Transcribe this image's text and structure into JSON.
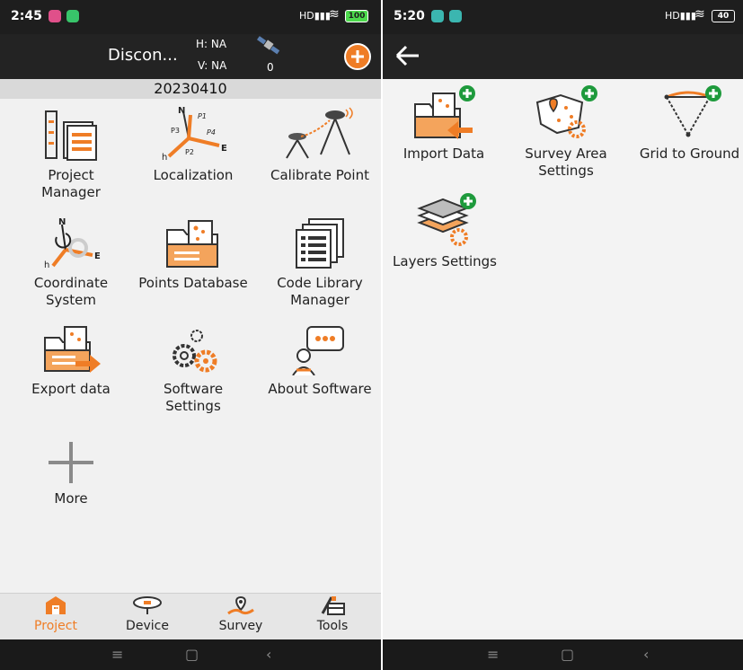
{
  "left": {
    "status": {
      "time": "2:45",
      "battery": "100"
    },
    "header": {
      "connection": "Discon...",
      "h_label": "H: NA",
      "v_label": "V: NA",
      "sat_count": "0"
    },
    "project_date": "20230410",
    "menu": [
      {
        "line1": "Project",
        "line2": "Manager"
      },
      {
        "line1": "Localization",
        "line2": ""
      },
      {
        "line1": "Calibrate Point",
        "line2": ""
      },
      {
        "line1": "Coordinate",
        "line2": "System"
      },
      {
        "line1": "Points Database",
        "line2": ""
      },
      {
        "line1": "Code Library",
        "line2": "Manager"
      },
      {
        "line1": "Export data",
        "line2": ""
      },
      {
        "line1": "Software",
        "line2": "Settings"
      },
      {
        "line1": "About Software",
        "line2": ""
      },
      {
        "line1": "More",
        "line2": ""
      }
    ],
    "localization_labels": {
      "n": "N",
      "e": "E",
      "h": "h",
      "p1": "P1",
      "p2": "P2",
      "p3": "P3",
      "p4": "P4"
    },
    "coord_labels": {
      "n": "N",
      "e": "E",
      "h": "h"
    },
    "nav": [
      "Project",
      "Device",
      "Survey",
      "Tools"
    ]
  },
  "right": {
    "status": {
      "time": "5:20",
      "battery": "40"
    },
    "menu": [
      {
        "line1": "Import Data",
        "line2": ""
      },
      {
        "line1": "Survey Area",
        "line2": "Settings"
      },
      {
        "line1": "Grid to Ground",
        "line2": ""
      },
      {
        "line1": "Layers Settings",
        "line2": ""
      }
    ]
  },
  "colors": {
    "accent": "#ef7d26",
    "dark": "#232323",
    "plus_green": "#1e9a3c",
    "icon_dark": "#333333"
  },
  "signal_text": "HD"
}
